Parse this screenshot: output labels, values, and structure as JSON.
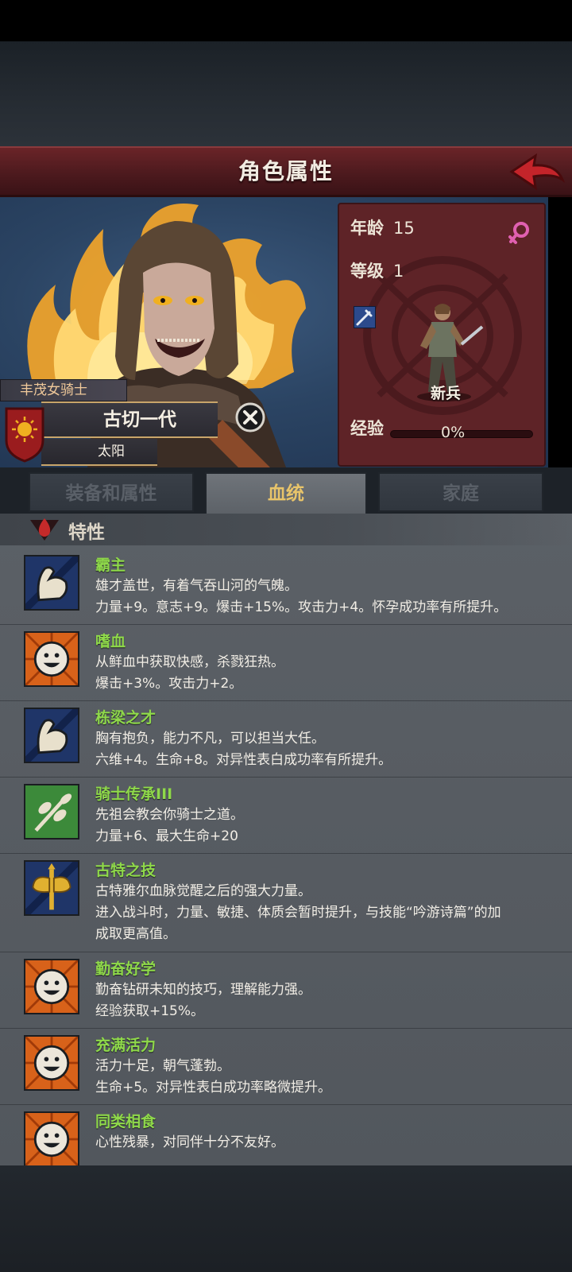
{
  "header": {
    "title": "角色属性"
  },
  "character": {
    "house": "丰茂女骑士",
    "name": "古切一代",
    "title": "太阳"
  },
  "stats": {
    "age_label": "年龄",
    "age_value": "15",
    "level_label": "等级",
    "level_value": "1",
    "unit_label": "新兵",
    "exp_label": "经验",
    "exp_value": "0%",
    "exp_fraction": 0
  },
  "tabs": [
    {
      "label": "装备和属性"
    },
    {
      "label": "血统"
    },
    {
      "label": "家庭"
    }
  ],
  "traits_section": {
    "label": "特性"
  },
  "traits": [
    {
      "icon": "flexed-arm-icon",
      "name": "霸主",
      "lines": [
        "雄才盖世，有着气吞山河的气魄。",
        "力量+9。意志+9。爆击+15%。攻击力+4。怀孕成功率有所提升。"
      ]
    },
    {
      "icon": "smiley-face-icon",
      "name": "嗜血",
      "lines": [
        "从鲜血中获取快感，杀戮狂热。",
        "爆击+3%。攻击力+2。"
      ]
    },
    {
      "icon": "flexed-arm-icon",
      "name": "栋梁之才",
      "lines": [
        "胸有抱负，能力不凡，可以担当大任。",
        "六维+4。生命+8。对异性表白成功率有所提升。"
      ]
    },
    {
      "icon": "leaf-branch-icon",
      "name": "骑士传承III",
      "lines": [
        "先祖会教会你骑士之道。",
        "力量+6、最大生命+20"
      ]
    },
    {
      "icon": "battle-axe-icon",
      "name": "古特之技",
      "lines": [
        "古特雅尔血脉觉醒之后的强大力量。",
        "进入战斗时，力量、敏捷、体质会暂时提升，与技能“吟游诗篇”的加",
        "成取更高值。"
      ]
    },
    {
      "icon": "smiley-face-icon",
      "name": "勤奋好学",
      "lines": [
        "勤奋钻研未知的技巧，理解能力强。",
        "经验获取+15%。"
      ]
    },
    {
      "icon": "smiley-face-icon",
      "name": "充满活力",
      "lines": [
        "活力十足，朝气蓬勃。",
        "生命+5。对异性表白成功率略微提升。"
      ]
    },
    {
      "icon": "smiley-face-icon",
      "name": "同类相食",
      "lines": [
        "心性残暴，对同伴十分不友好。"
      ]
    }
  ],
  "colors": {
    "title_bar": "#5a1e22",
    "trait_name": "#8fd94a",
    "tab_active_text": "#e8c46a",
    "panel_blue": "#2b4463"
  }
}
